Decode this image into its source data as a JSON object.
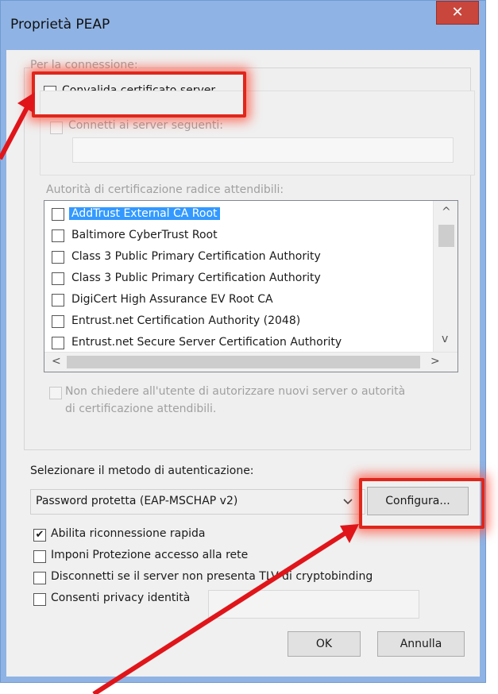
{
  "window": {
    "title": "Proprietà PEAP",
    "close_glyph": "✕"
  },
  "connection": {
    "group_label": "Per la connessione:",
    "validate_cert_label": "Convalida certificato server",
    "connect_servers_label": "Connetti ai server seguenti:",
    "servers_value": ""
  },
  "ca": {
    "label": "Autorità di certificazione radice attendibili:",
    "items": [
      {
        "label": "AddTrust External CA Root",
        "checked": false,
        "selected": true
      },
      {
        "label": "Baltimore CyberTrust Root",
        "checked": false,
        "selected": false
      },
      {
        "label": "Class 3 Public Primary Certification Authority",
        "checked": false,
        "selected": false
      },
      {
        "label": "Class 3 Public Primary Certification Authority",
        "checked": false,
        "selected": false
      },
      {
        "label": "DigiCert High Assurance EV Root CA",
        "checked": false,
        "selected": false
      },
      {
        "label": "Entrust.net Certification Authority (2048)",
        "checked": false,
        "selected": false
      },
      {
        "label": "Entrust.net Secure Server Certification Authority",
        "checked": false,
        "selected": false
      }
    ],
    "scroll_up": "^",
    "scroll_down": "v",
    "scroll_left": "<",
    "scroll_right": ">"
  },
  "no_prompt_label_line1": "Non chiedere all'utente di autorizzare nuovi server o autorità",
  "no_prompt_label_line2": "di certificazione attendibili.",
  "auth": {
    "label": "Selezionare il metodo di autenticazione:",
    "selected_method": "Password protetta (EAP-MSCHAP v2)",
    "configure_label": "Configura..."
  },
  "options": [
    {
      "label": "Abilita riconnessione rapida",
      "checked": true
    },
    {
      "label": "Imponi Protezione accesso alla rete",
      "checked": false
    },
    {
      "label": "Disconnetti se il server non presenta TLV di cryptobinding",
      "checked": false
    },
    {
      "label": "Consenti privacy identità",
      "checked": false
    }
  ],
  "identity_value": "",
  "buttons": {
    "ok": "OK",
    "cancel": "Annulla"
  },
  "colors": {
    "accent": "#8fb3e4",
    "close": "#c8463c",
    "selection": "#3399ff",
    "annotation": "#e0261b"
  },
  "check_glyph": "✔"
}
